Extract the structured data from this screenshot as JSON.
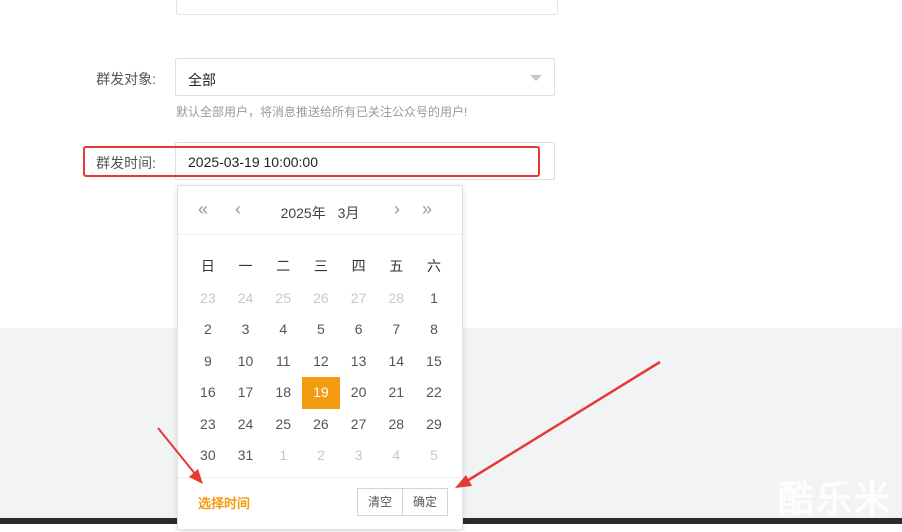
{
  "form": {
    "target_label": "群发对象:",
    "target_value": "全部",
    "target_hint": "默认全部用户，将消息推送给所有已关注公众号的用户!",
    "time_label": "群发时间:",
    "time_value": "2025-03-19 10:00:00"
  },
  "picker": {
    "nav": {
      "prev_year": "«",
      "prev_month": "‹",
      "next_month": "›",
      "next_year": "»"
    },
    "year_label": "2025年",
    "month_label": "3月",
    "weekdays": [
      "日",
      "一",
      "二",
      "三",
      "四",
      "五",
      "六"
    ],
    "weeks": [
      [
        {
          "d": "23",
          "m": true
        },
        {
          "d": "24",
          "m": true
        },
        {
          "d": "25",
          "m": true
        },
        {
          "d": "26",
          "m": true
        },
        {
          "d": "27",
          "m": true
        },
        {
          "d": "28",
          "m": true
        },
        {
          "d": "1"
        }
      ],
      [
        {
          "d": "2"
        },
        {
          "d": "3"
        },
        {
          "d": "4"
        },
        {
          "d": "5"
        },
        {
          "d": "6"
        },
        {
          "d": "7"
        },
        {
          "d": "8"
        }
      ],
      [
        {
          "d": "9"
        },
        {
          "d": "10"
        },
        {
          "d": "11"
        },
        {
          "d": "12"
        },
        {
          "d": "13"
        },
        {
          "d": "14"
        },
        {
          "d": "15"
        }
      ],
      [
        {
          "d": "16"
        },
        {
          "d": "17"
        },
        {
          "d": "18"
        },
        {
          "d": "19",
          "s": true
        },
        {
          "d": "20"
        },
        {
          "d": "21"
        },
        {
          "d": "22"
        }
      ],
      [
        {
          "d": "23"
        },
        {
          "d": "24"
        },
        {
          "d": "25"
        },
        {
          "d": "26"
        },
        {
          "d": "27"
        },
        {
          "d": "28"
        },
        {
          "d": "29"
        }
      ],
      [
        {
          "d": "30"
        },
        {
          "d": "31"
        },
        {
          "d": "1",
          "m": true
        },
        {
          "d": "2",
          "m": true
        },
        {
          "d": "3",
          "m": true
        },
        {
          "d": "4",
          "m": true
        },
        {
          "d": "5",
          "m": true
        }
      ]
    ],
    "select_time_label": "选择时间",
    "clear_label": "清空",
    "confirm_label": "确定"
  },
  "watermark": "酷乐米",
  "colors": {
    "accent": "#f39c12",
    "highlight": "#e53935"
  }
}
